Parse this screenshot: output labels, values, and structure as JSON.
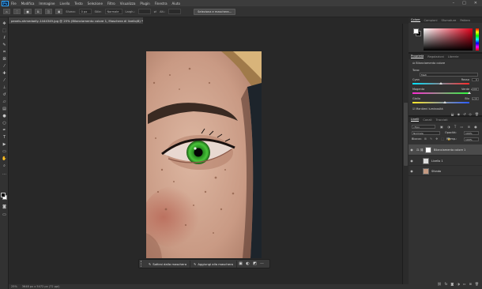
{
  "menu": {
    "app_badge": "Ps",
    "items": [
      "File",
      "Modifica",
      "Immagine",
      "Livello",
      "Testo",
      "Selezione",
      "Filtro",
      "Visualizza",
      "Plugin",
      "Finestra",
      "Aiuto"
    ]
  },
  "options": {
    "sfumatura_label": "Sfuma:",
    "sfumatura_value": "0 px",
    "stile_label": "Stile:",
    "stile_value": "Normale",
    "largh_label": "Largh.:",
    "alt_label": "Alt.:",
    "select_mask_button": "Seleziona e maschera..."
  },
  "document": {
    "tab_title": "pexels-ahmedadly-1444349.jpg @ 25% (Bilanciamento colore 1, Maschera di livello/8) *",
    "status_zoom": "25%",
    "status_info": "3648 px x 5472 px (72 ppi)"
  },
  "taskbar": {
    "subtract_label": "Sottrai dalla maschera",
    "add_label": "Aggiungi alla maschera",
    "more": "···"
  },
  "color_panel": {
    "tabs": [
      "Colore",
      "Campioni",
      "Sfumature",
      "Pattern"
    ],
    "accent": "#e1001a"
  },
  "properties_panel": {
    "tabs": [
      "Proprietà",
      "Regolazioni",
      "Librerie"
    ],
    "adjustment_title": "Bilanciamento colore",
    "tone_label": "Tono:",
    "tone_value": "Medi",
    "sliders": [
      {
        "left": "Cyan",
        "right": "Rosso",
        "value": "0",
        "knob": 0.5
      },
      {
        "left": "Magenta",
        "right": "Verde",
        "value": "+100",
        "knob": 1.0
      },
      {
        "left": "Giallo",
        "right": "Blu",
        "value": "+14",
        "knob": 0.57
      }
    ],
    "preserve_label": "Mantieni luminosità"
  },
  "layers_panel": {
    "tabs": [
      "Livelli",
      "Canali",
      "Tracciati"
    ],
    "filter_label": "Tipo",
    "blend_mode": "Normale",
    "opacity_label": "Opacità:",
    "opacity_value": "100%",
    "lock_label": "Blocca:",
    "fill_label": "Riemp.:",
    "fill_value": "100%",
    "layers": [
      {
        "name": "Bilanciamento colore 1",
        "selected": true
      },
      {
        "name": "Livello 1",
        "selected": false
      },
      {
        "name": "Sfondo",
        "selected": false
      }
    ]
  }
}
